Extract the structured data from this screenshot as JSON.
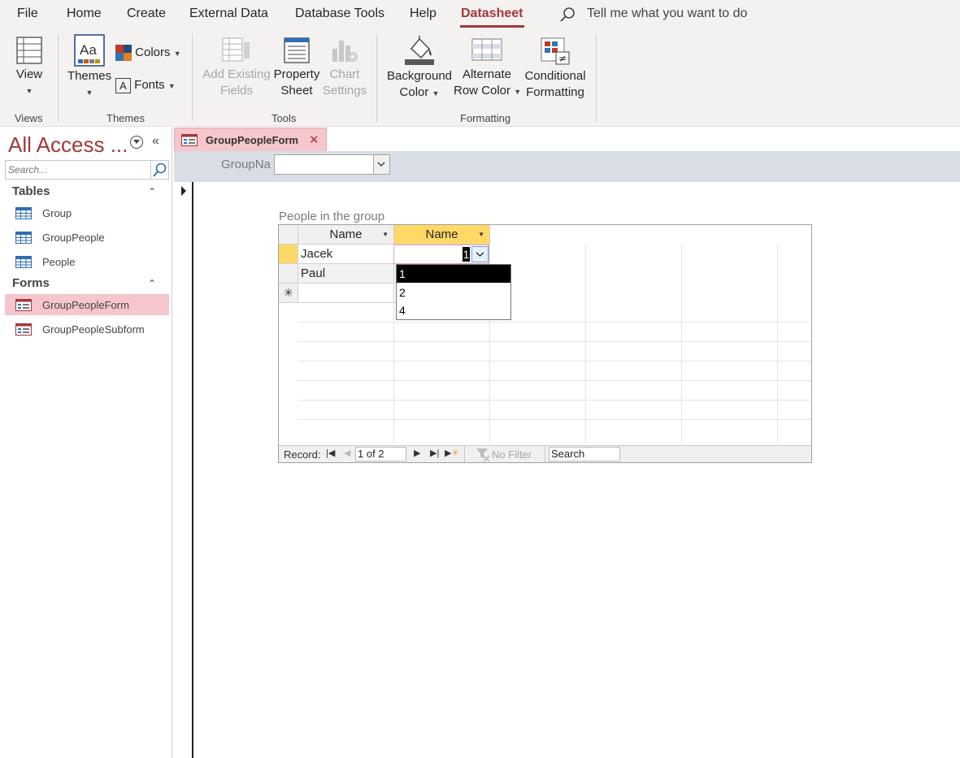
{
  "menu": {
    "items": [
      "File",
      "Home",
      "Create",
      "External Data",
      "Database Tools",
      "Help",
      "Datasheet"
    ],
    "active": "Datasheet",
    "tell_me": "Tell me what you want to do"
  },
  "ribbon": {
    "view": "View",
    "themes": "Themes",
    "colors": "Colors",
    "fonts": "Fonts",
    "add_existing_fields_1": "Add Existing",
    "add_existing_fields_2": "Fields",
    "property_sheet_1": "Property",
    "property_sheet_2": "Sheet",
    "chart_settings_1": "Chart",
    "chart_settings_2": "Settings",
    "background_color_1": "Background",
    "background_color_2": "Color",
    "alternate_row_color_1": "Alternate",
    "alternate_row_color_2": "Row Color",
    "conditional_formatting_1": "Conditional",
    "conditional_formatting_2": "Formatting",
    "groups": {
      "views": "Views",
      "themes": "Themes",
      "tools": "Tools",
      "formatting": "Formatting"
    }
  },
  "nav": {
    "title": "All Access ...",
    "search_placeholder": "Search...",
    "sections": [
      {
        "label": "Tables",
        "items": [
          "Group",
          "GroupPeople",
          "People"
        ]
      },
      {
        "label": "Forms",
        "items": [
          "GroupPeopleForm",
          "GroupPeopleSubform"
        ]
      }
    ],
    "selected": "GroupPeopleForm"
  },
  "document": {
    "tab_label": "GroupPeopleForm",
    "groupname_label": "GroupNa",
    "groupname_value": "",
    "subform_caption": "People in the group",
    "columns": [
      "Name",
      "Name"
    ],
    "rows": [
      {
        "col1": "Jacek",
        "col2": "1"
      },
      {
        "col1": "Paul",
        "col2": ""
      }
    ],
    "dropdown_options": [
      "1",
      "2",
      "4"
    ],
    "dropdown_selected": "1",
    "record_nav": {
      "label": "Record:",
      "counter": "1 of 2",
      "no_filter": "No Filter",
      "search": "Search"
    }
  },
  "colors": {
    "accent": "#a4373a",
    "selection_pink": "#f5c6cb",
    "header_yellow": "#ffd966"
  }
}
